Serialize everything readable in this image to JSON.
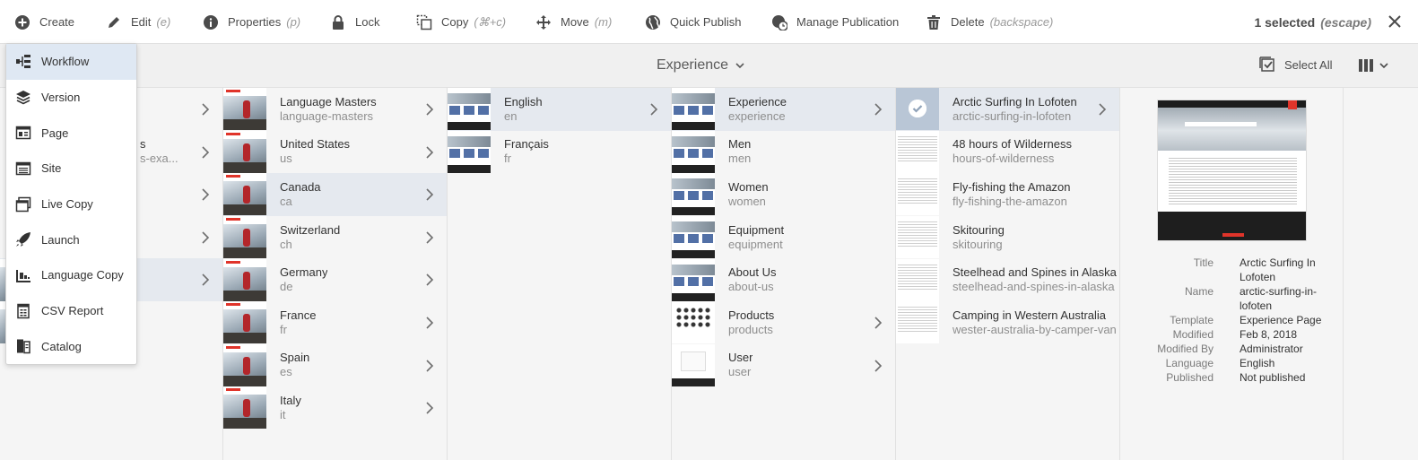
{
  "actions": {
    "create": {
      "label": "Create"
    },
    "edit": {
      "label": "Edit",
      "shortcut": "(e)"
    },
    "properties": {
      "label": "Properties",
      "shortcut": "(p)"
    },
    "lock": {
      "label": "Lock"
    },
    "copy": {
      "label": "Copy",
      "shortcut": "(⌘+c)"
    },
    "move": {
      "label": "Move",
      "shortcut": "(m)"
    },
    "quick_publish": {
      "label": "Quick Publish"
    },
    "manage_publication": {
      "label": "Manage Publication"
    },
    "delete": {
      "label": "Delete",
      "shortcut": "(backspace)"
    }
  },
  "selection": {
    "count_label": "1 selected",
    "escape_hint": "(escape)"
  },
  "titlebar": {
    "title": "Experience",
    "select_all": "Select All"
  },
  "create_menu": [
    {
      "label": "Workflow",
      "icon": "workflow-icon"
    },
    {
      "label": "Version",
      "icon": "layers-icon"
    },
    {
      "label": "Page",
      "icon": "page-icon"
    },
    {
      "label": "Site",
      "icon": "site-icon"
    },
    {
      "label": "Live Copy",
      "icon": "live-copy-icon"
    },
    {
      "label": "Launch",
      "icon": "launch-icon"
    },
    {
      "label": "Language Copy",
      "icon": "language-copy-icon"
    },
    {
      "label": "CSV Report",
      "icon": "csv-report-icon"
    },
    {
      "label": "Catalog",
      "icon": "catalog-icon"
    }
  ],
  "column0": {
    "partial_items": [
      {
        "title_fragment": "s",
        "sub_fragment": "s-exa..."
      }
    ]
  },
  "column1": {
    "items": [
      {
        "title": "Language Masters",
        "name": "language-masters"
      },
      {
        "title": "United States",
        "name": "us"
      },
      {
        "title": "Canada",
        "name": "ca"
      },
      {
        "title": "Switzerland",
        "name": "ch"
      },
      {
        "title": "Germany",
        "name": "de"
      },
      {
        "title": "France",
        "name": "fr"
      },
      {
        "title": "Spain",
        "name": "es"
      },
      {
        "title": "Italy",
        "name": "it"
      }
    ]
  },
  "column2": {
    "items": [
      {
        "title": "English",
        "name": "en"
      },
      {
        "title": "Français",
        "name": "fr"
      }
    ]
  },
  "column3": {
    "items": [
      {
        "title": "Experience",
        "name": "experience"
      },
      {
        "title": "Men",
        "name": "men"
      },
      {
        "title": "Women",
        "name": "women"
      },
      {
        "title": "Equipment",
        "name": "equipment"
      },
      {
        "title": "About Us",
        "name": "about-us"
      },
      {
        "title": "Products",
        "name": "products"
      },
      {
        "title": "User",
        "name": "user"
      }
    ]
  },
  "column4": {
    "items": [
      {
        "title": "Arctic Surfing In Lofoten",
        "name": "arctic-surfing-in-lofoten"
      },
      {
        "title": "48 hours of Wilderness",
        "name": "hours-of-wilderness"
      },
      {
        "title": "Fly-fishing the Amazon",
        "name": "fly-fishing-the-amazon"
      },
      {
        "title": "Skitouring",
        "name": "skitouring"
      },
      {
        "title": "Steelhead and Spines in Alaska",
        "name": "steelhead-and-spines-in-alaska"
      },
      {
        "title": "Camping in Western Australia",
        "name": "wester-australia-by-camper-van"
      }
    ]
  },
  "preview": {
    "meta": [
      {
        "label": "Title",
        "value": "Arctic Surfing In Lofoten"
      },
      {
        "label": "Name",
        "value": "arctic-surfing-in-lofoten"
      },
      {
        "label": "Template",
        "value": "Experience Page"
      },
      {
        "label": "Modified",
        "value": "Feb 8, 2018"
      },
      {
        "label": "Modified By",
        "value": "Administrator"
      },
      {
        "label": "Language",
        "value": "English"
      },
      {
        "label": "Published",
        "value": "Not published"
      }
    ]
  }
}
